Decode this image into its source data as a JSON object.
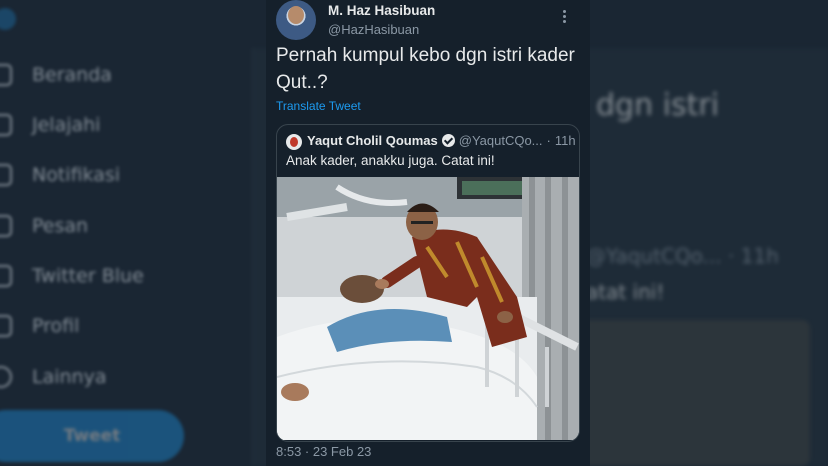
{
  "background": {
    "nav_items": [
      {
        "label": "Beranda",
        "icon": "home-icon"
      },
      {
        "label": "Jelajahi",
        "icon": "hashtag-icon"
      },
      {
        "label": "Notifikasi",
        "icon": "bell-icon"
      },
      {
        "label": "Pesan",
        "icon": "mail-icon"
      },
      {
        "label": "Twitter Blue",
        "icon": "twitter-blue-icon"
      },
      {
        "label": "Profil",
        "icon": "person-icon"
      },
      {
        "label": "Lainnya",
        "icon": "more-circle-icon"
      }
    ],
    "tweet_button": "Tweet",
    "main_big_text": "dgn istri",
    "main_handle_text": "@YaqutCQo... · 11h",
    "main_catat_text": "atat ini!"
  },
  "tweet": {
    "author_name": "M. Haz Hasibuan",
    "author_handle": "@HazHasibuan",
    "text": "Pernah kumpul kebo dgn istri kader Qut..?",
    "translate_label": "Translate Tweet",
    "timestamp": "8:53 · 23 Feb 23"
  },
  "quote": {
    "author_name": "Yaqut Cholil Qoumas",
    "author_handle": "@YaqutCQo...",
    "separator": "·",
    "time": "11h",
    "text": "Anak kader, anakku juga. Catat ini!"
  },
  "colors": {
    "background": "#15202b",
    "text": "#e7e9ea",
    "secondary": "#8b98a5",
    "accent": "#1d9bf0",
    "border": "#38444d"
  }
}
